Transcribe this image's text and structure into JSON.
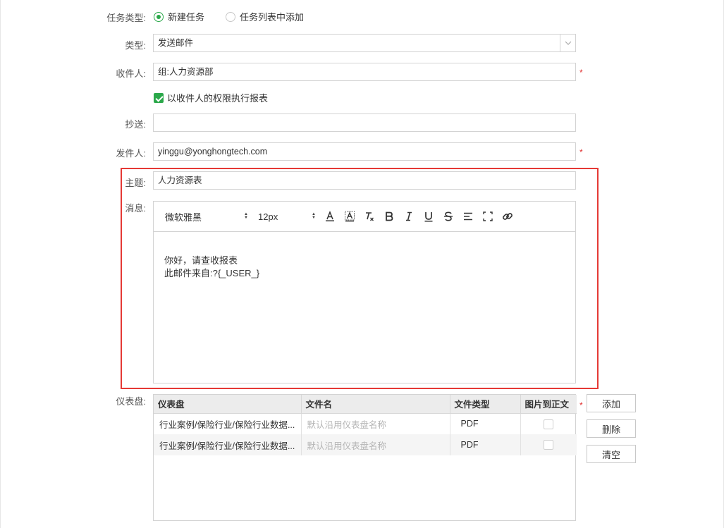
{
  "form": {
    "task_type": {
      "label": "任务类型:",
      "options": [
        {
          "label": "新建任务",
          "selected": true
        },
        {
          "label": "任务列表中添加",
          "selected": false
        }
      ]
    },
    "type": {
      "label": "类型:",
      "value": "发送邮件"
    },
    "recipient": {
      "label": "收件人:",
      "value": "组:人力资源部",
      "required_mark": "*"
    },
    "recipient_permission": {
      "label": "以收件人的权限执行报表",
      "checked": true
    },
    "cc": {
      "label": "抄送:",
      "value": ""
    },
    "sender": {
      "label": "发件人:",
      "value": "yinggu@yonghongtech.com",
      "required_mark": "*"
    },
    "subject": {
      "label": "主题:",
      "value": "人力资源表"
    },
    "message": {
      "label": "消息:",
      "toolbar": {
        "font_family": "微软雅黑",
        "font_size": "12px",
        "buttons": [
          "font-color-icon",
          "background-color-icon",
          "clear-format-icon",
          "bold-icon",
          "italic-icon",
          "underline-icon",
          "strikethrough-icon",
          "align-icon",
          "fullscreen-icon",
          "link-icon"
        ]
      },
      "body_lines": [
        "你好，请查收报表",
        "此邮件来自:?{_USER_}"
      ]
    },
    "dashboard": {
      "label": "仪表盘:",
      "required_mark": "*",
      "columns": [
        "仪表盘",
        "文件名",
        "文件类型",
        "图片到正文"
      ],
      "rows": [
        {
          "dashboard": "行业案例/保险行业/保险行业数据...",
          "filename_placeholder": "默认沿用仪表盘名称",
          "filetype": "PDF",
          "image_to_body": false
        },
        {
          "dashboard": "行业案例/保险行业/保险行业数据...",
          "filename_placeholder": "默认沿用仪表盘名称",
          "filetype": "PDF",
          "image_to_body": false
        }
      ],
      "buttons": {
        "add": "添加",
        "delete": "删除",
        "clear": "清空"
      }
    }
  },
  "colors": {
    "accent": "#2ba84a",
    "highlight_border": "#e53935",
    "required": "#e03030"
  }
}
